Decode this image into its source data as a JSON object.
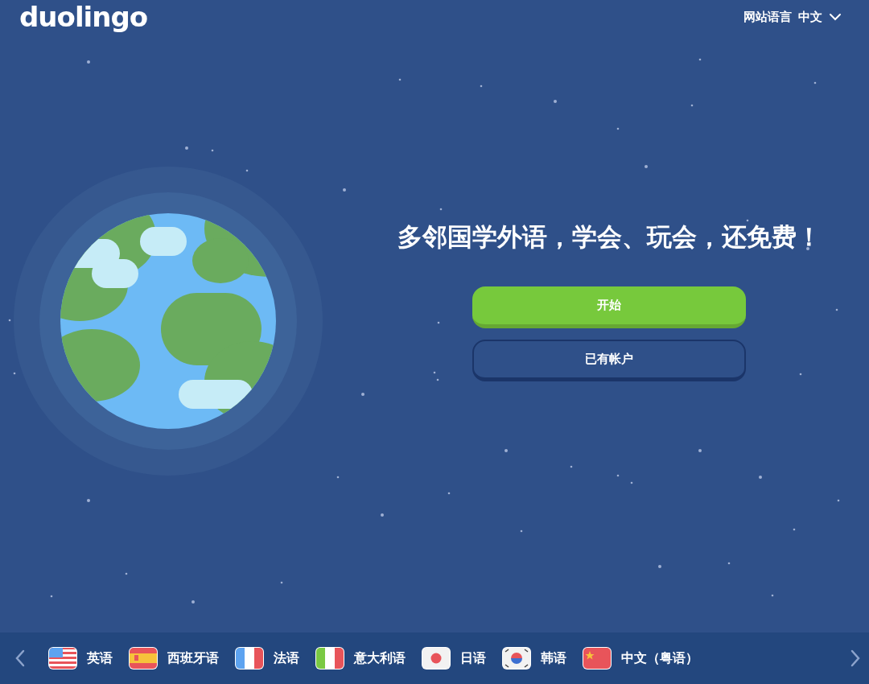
{
  "header": {
    "logo": "duolingo",
    "site_language_label": "网站语言",
    "site_language_value": "中文"
  },
  "hero": {
    "headline": "多邻国学外语，学会、玩会，还免费！",
    "buttons": [
      {
        "label": "开始",
        "kind": "primary"
      },
      {
        "label": "已有帐户",
        "kind": "secondary"
      }
    ]
  },
  "language_bar": {
    "languages": [
      {
        "label": "英语",
        "kind": "us"
      },
      {
        "label": "西班牙语",
        "kind": "es"
      },
      {
        "label": "法语",
        "kind": "fr"
      },
      {
        "label": "意大利语",
        "kind": "it"
      },
      {
        "label": "日语",
        "kind": "jp"
      },
      {
        "label": "韩语",
        "kind": "kr"
      },
      {
        "label": "中文（粤语）",
        "kind": "cn"
      }
    ]
  }
}
